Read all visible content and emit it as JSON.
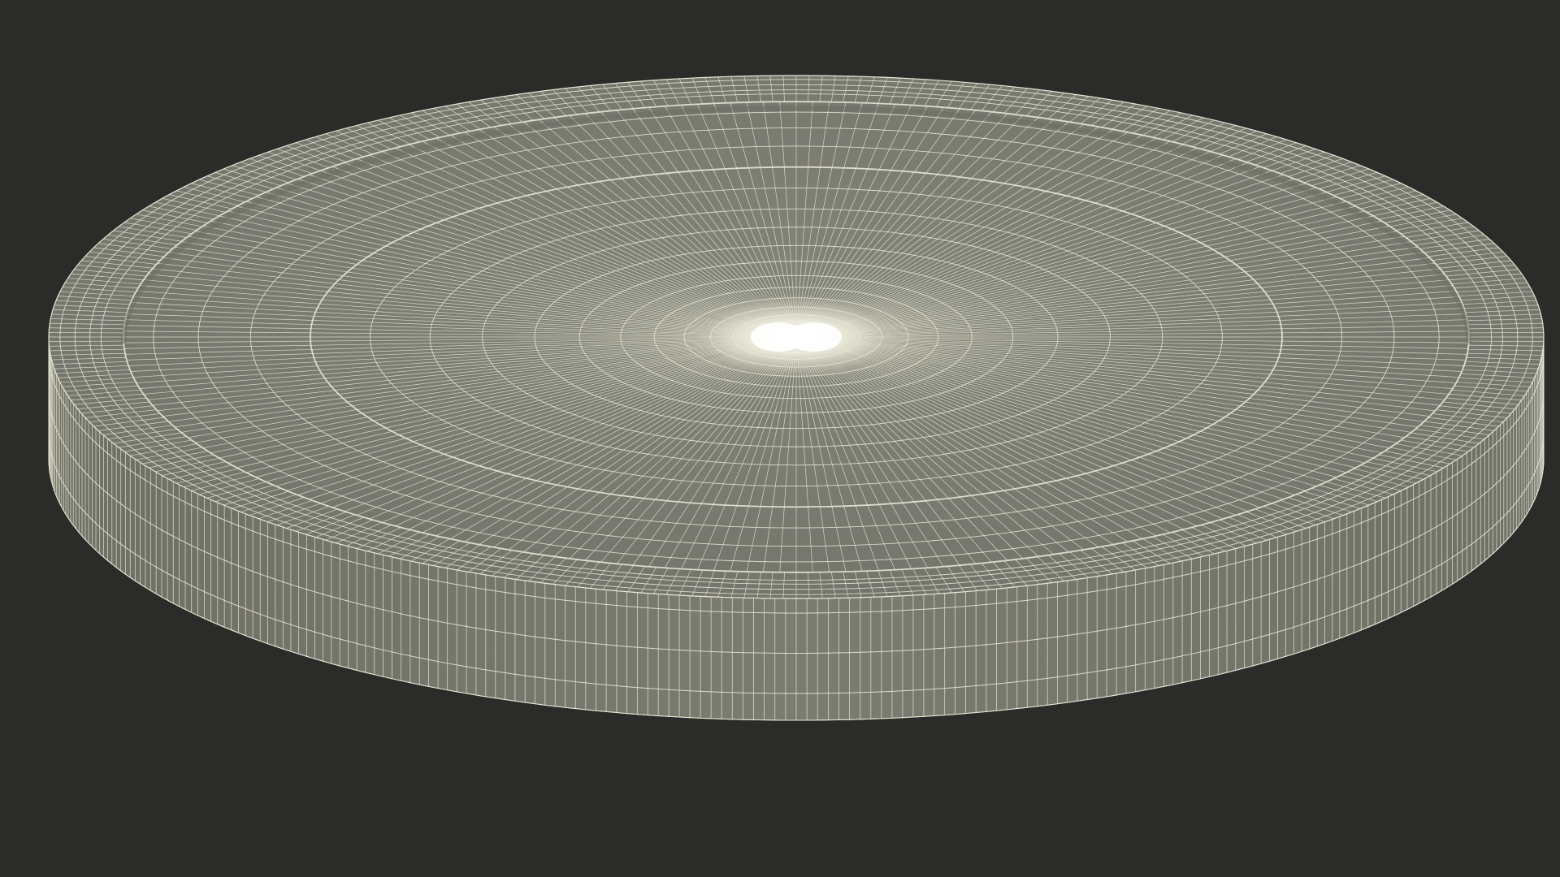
{
  "scene": {
    "subject": "wireframe-disc-lid",
    "colors": {
      "background": "#2b2b29",
      "surface": "#7a7b70",
      "surface_shadow": "#6b6c62",
      "side_wall": "#76776c",
      "wire": "#e8e6d4",
      "highlight": "#ffffff"
    }
  }
}
